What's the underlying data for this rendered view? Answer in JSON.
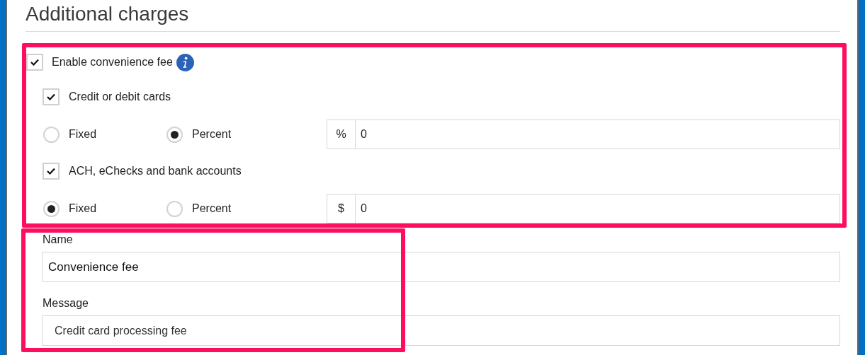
{
  "title": "Additional charges",
  "convenience_fee": {
    "label": "Enable convenience fee",
    "checked": true
  },
  "methods": [
    {
      "label": "Credit or debit cards",
      "checked": true,
      "options": [
        {
          "label": "Fixed",
          "selected": false
        },
        {
          "label": "Percent",
          "selected": true
        }
      ],
      "addon": "%",
      "value": "0"
    },
    {
      "label": "ACH, eChecks and bank accounts",
      "checked": true,
      "options": [
        {
          "label": "Fixed",
          "selected": true
        },
        {
          "label": "Percent",
          "selected": false
        }
      ],
      "addon": "$",
      "value": "0"
    }
  ],
  "name": {
    "label": "Name",
    "value": "Convenience fee"
  },
  "message": {
    "label": "Message",
    "value": "Credit card processing fee"
  }
}
